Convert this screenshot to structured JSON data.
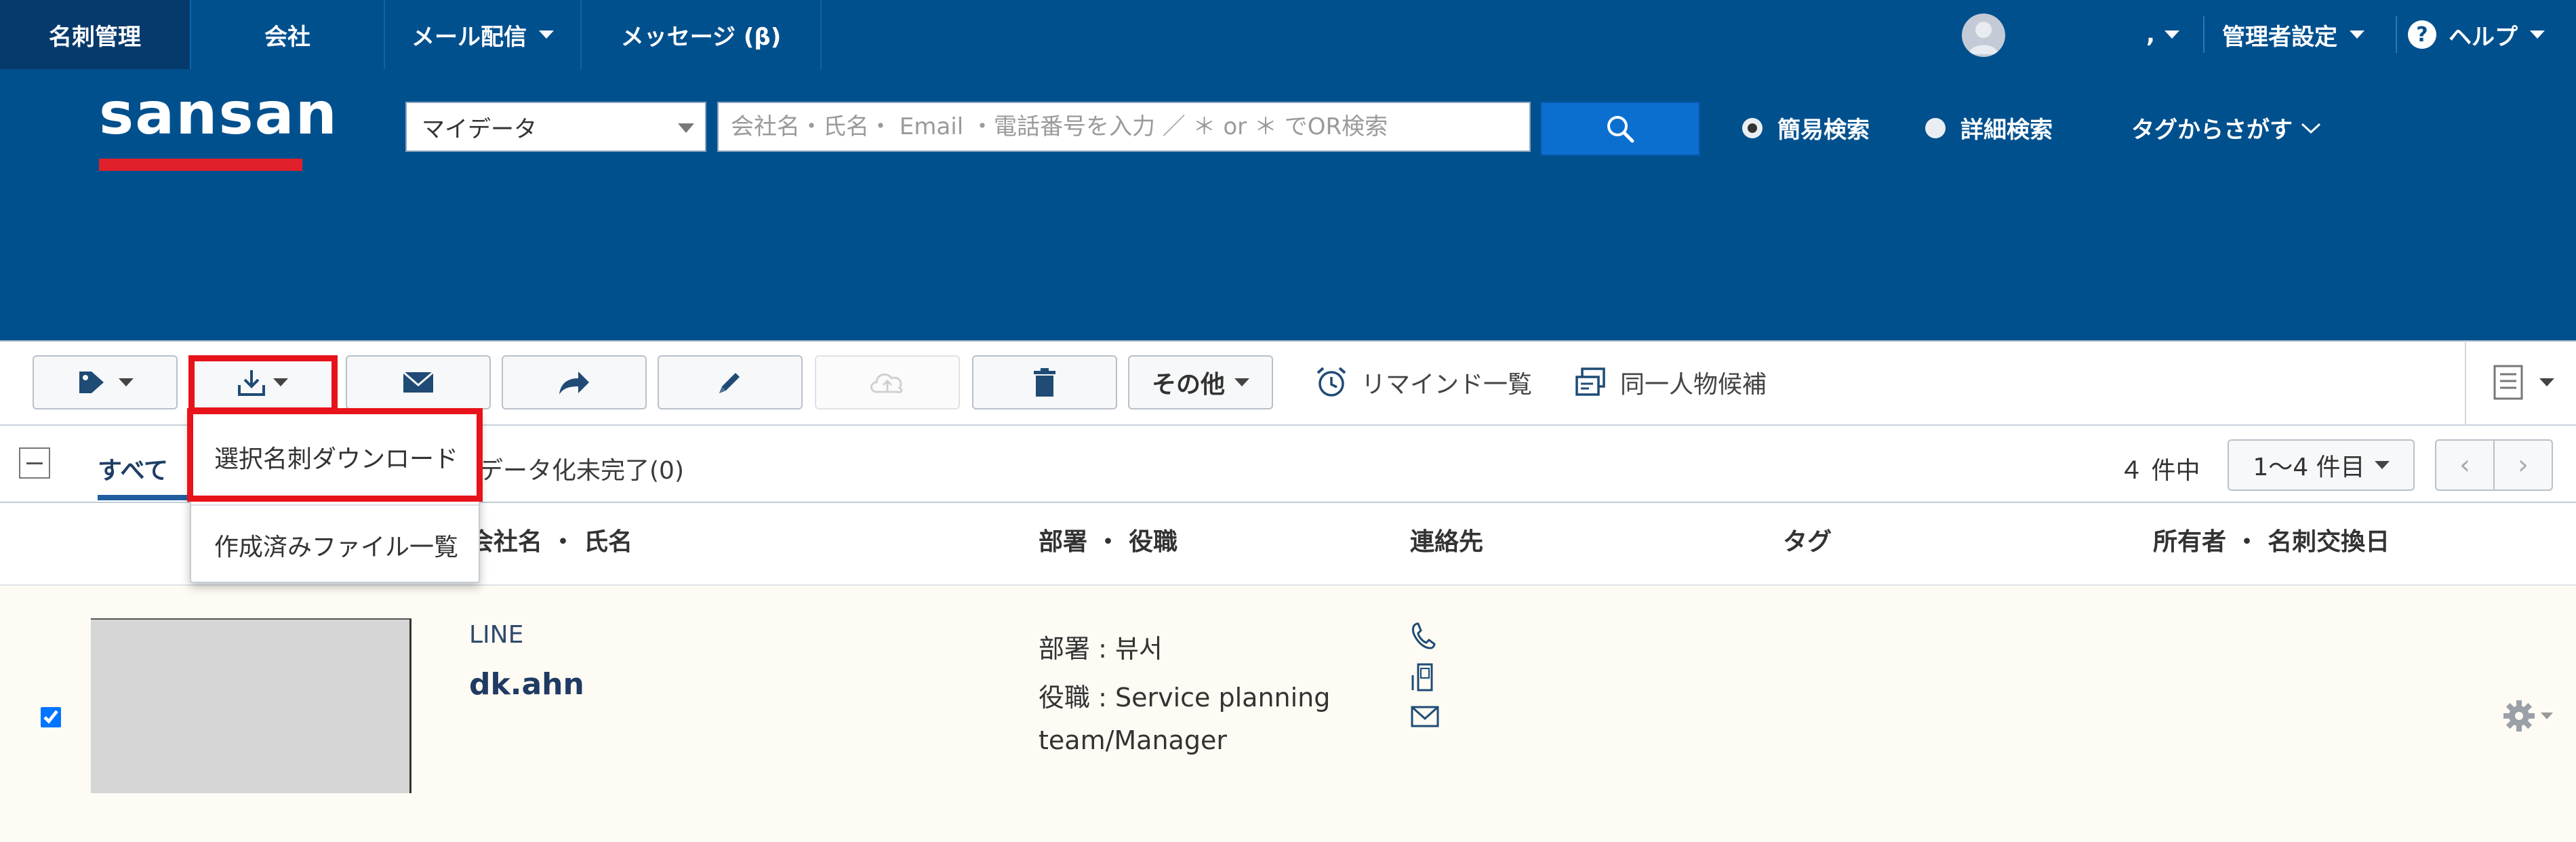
{
  "topnav": {
    "items": [
      {
        "label": "名刺管理",
        "active": true
      },
      {
        "label": "会社"
      },
      {
        "label": "メール配信"
      },
      {
        "label": "メッセージ (β)"
      }
    ],
    "user_label": ",",
    "admin_label": "管理者設定",
    "help_label": "ヘルプ"
  },
  "header": {
    "logo_text": "sansan",
    "scope_select": "マイデータ",
    "search_placeholder": "会社名・氏名・ Email ・電話番号を入力 ／ ＊ or ＊ でOR検索",
    "search_value": "",
    "radio_simple": "簡易検索",
    "radio_detail": "詳細検索",
    "tag_search": "タグからさがす"
  },
  "toolbar": {
    "other_label": "その他",
    "remind_label": "リマインド一覧",
    "duplicate_label": "同一人物候補"
  },
  "tabs": {
    "all_label": "すべて",
    "incomplete_label": "データ化未完了(0)",
    "count_label": "４ 件中",
    "page_select": "1〜4 件目"
  },
  "columns": {
    "company_name": "会社名 ・ 氏名",
    "dept_title": "部署 ・ 役職",
    "contact": "連絡先",
    "tag": "タグ",
    "owner_date": "所有者 ・ 名刺交換日"
  },
  "row": {
    "company": "LINE",
    "name": "dk.ahn",
    "dept": "部署 : 뷰서",
    "title_line1": "役職 : Service planning",
    "title_line2": "team/Manager",
    "checked": true
  },
  "download_menu": {
    "item_selected": "選択名刺ダウンロード",
    "item_files": "作成済みファイル一覧"
  },
  "colors": {
    "nav_bg": "#00508e",
    "active_nav": "#073a6c",
    "highlight": "#e8121b",
    "logo_bar": "#e0202a",
    "search_button": "#0b6fd0",
    "row_bg": "#fdfbf3"
  }
}
